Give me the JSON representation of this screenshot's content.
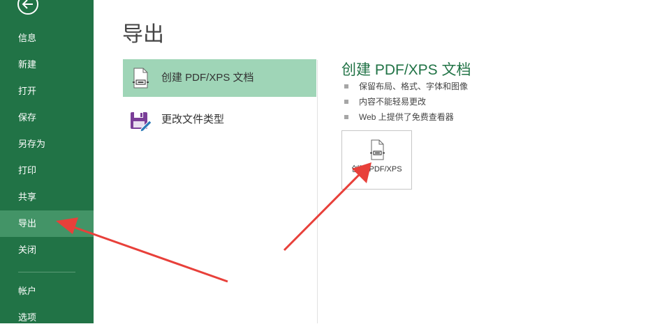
{
  "sidebar": {
    "items": [
      {
        "label": "信息"
      },
      {
        "label": "新建"
      },
      {
        "label": "打开"
      },
      {
        "label": "保存"
      },
      {
        "label": "另存为"
      },
      {
        "label": "打印"
      },
      {
        "label": "共享"
      },
      {
        "label": "导出"
      },
      {
        "label": "关闭"
      },
      {
        "label": "帐户"
      },
      {
        "label": "选项"
      }
    ],
    "active": "导出",
    "background": "#217346",
    "active_background": "#439467"
  },
  "page": {
    "title": "导出"
  },
  "options": [
    {
      "label": "创建 PDF/XPS 文档",
      "icon": "pdf-document-icon",
      "selected": true
    },
    {
      "label": "更改文件类型",
      "icon": "save-as-edit-icon",
      "selected": false
    }
  ],
  "detail": {
    "title": "创建 PDF/XPS 文档",
    "bullets": [
      "保留布局、格式、字体和图像",
      "内容不能轻易更改",
      "Web 上提供了免费查看器"
    ],
    "button_label": "创建 PDF/XPS",
    "button_icon": "pdf-document-icon",
    "accent": "#217346"
  },
  "annotations": {
    "arrow_color": "#e8403a"
  }
}
